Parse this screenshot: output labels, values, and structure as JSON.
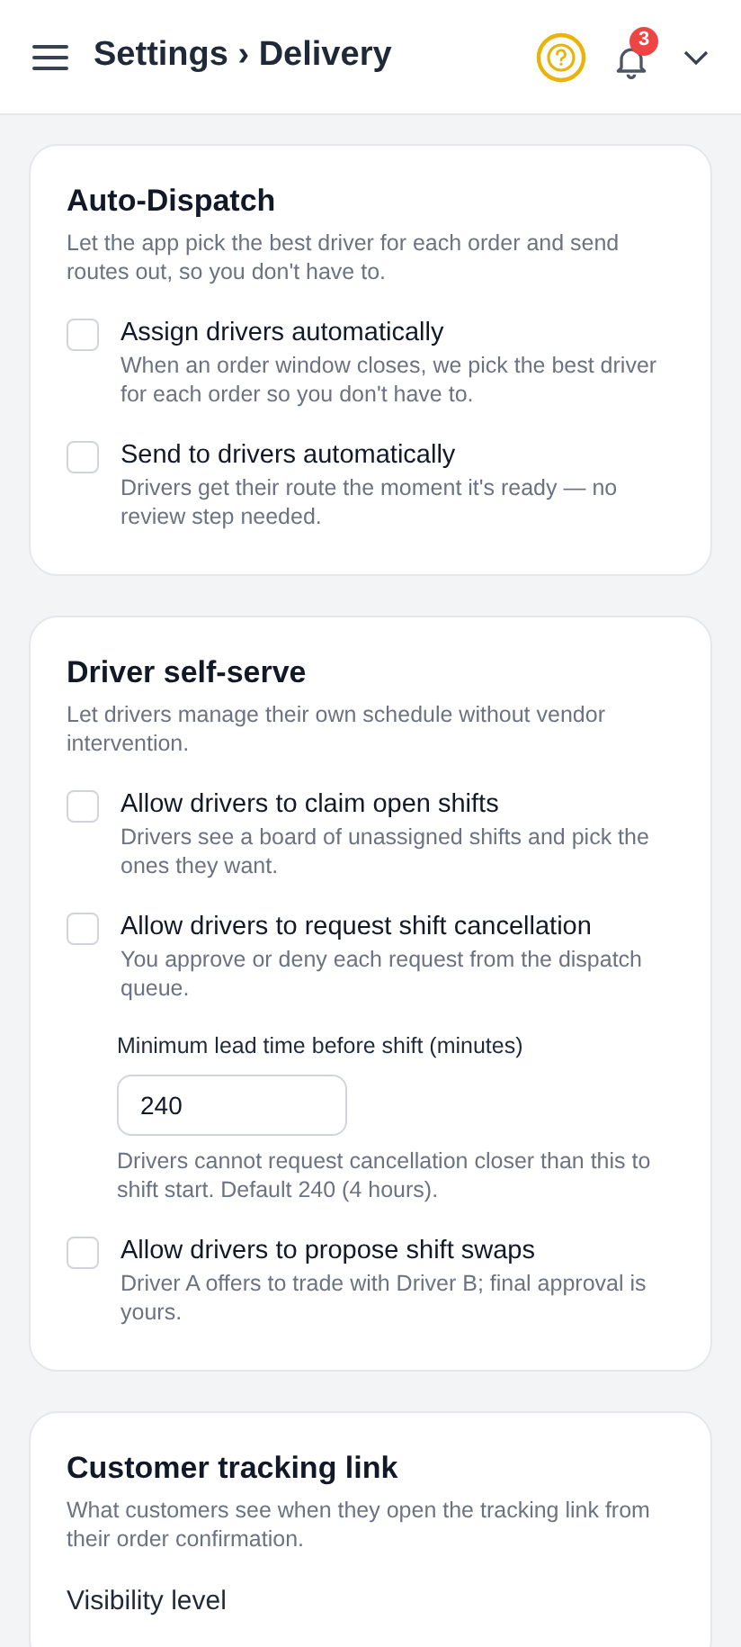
{
  "header": {
    "title": "Settings › Delivery",
    "notification_count": "3"
  },
  "sections": [
    {
      "title": "Auto-Dispatch",
      "description": "Let the app pick the best driver for each order and send routes out, so you don't have to.",
      "items": [
        {
          "kind": "checkbox",
          "label": "Assign drivers automatically",
          "description": "When an order window closes, we pick the best driver for each order so you don't have to.",
          "checked": false
        },
        {
          "kind": "checkbox",
          "label": "Send to drivers automatically",
          "description": "Drivers get their route the moment it's ready — no review step needed.",
          "checked": false
        }
      ]
    },
    {
      "title": "Driver self-serve",
      "description": "Let drivers manage their own schedule without vendor intervention.",
      "items": [
        {
          "kind": "checkbox",
          "label": "Allow drivers to claim open shifts",
          "description": "Drivers see a board of unassigned shifts and pick the ones they want.",
          "checked": false
        },
        {
          "kind": "checkbox",
          "label": "Allow drivers to request shift cancellation",
          "description": "You approve or deny each request from the dispatch queue.",
          "checked": false
        },
        {
          "kind": "number_field",
          "label": "Minimum lead time before shift (minutes)",
          "value": "240",
          "help": "Drivers cannot request cancellation closer than this to shift start. Default 240 (4 hours)."
        },
        {
          "kind": "checkbox",
          "label": "Allow drivers to propose shift swaps",
          "description": "Driver A offers to trade with Driver B; final approval is yours.",
          "checked": false
        }
      ]
    },
    {
      "title": "Customer tracking link",
      "description": "What customers see when they open the tracking link from their order confirmation.",
      "items": [
        {
          "kind": "field_label",
          "label": "Visibility level"
        }
      ]
    }
  ]
}
